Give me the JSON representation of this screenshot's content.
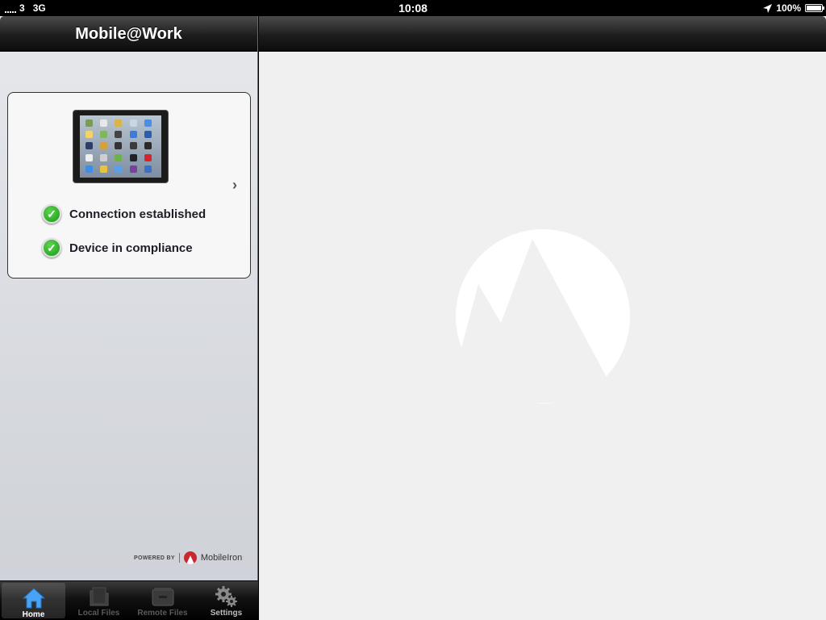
{
  "status_bar": {
    "carrier": "3",
    "network": "3G",
    "time": "10:08",
    "battery": "100%",
    "battery_level": 1.0,
    "location_icon": "location-arrow-icon"
  },
  "master": {
    "title": "Mobile@Work",
    "device_card": {
      "chevron_icon": "chevron-right-icon",
      "statuses": [
        {
          "label": "Connection established",
          "icon": "check-icon"
        },
        {
          "label": "Device in compliance",
          "icon": "check-icon"
        }
      ]
    },
    "powered_by": {
      "prefix": "POWERED BY",
      "brand": "MobileIron"
    }
  },
  "tabbar": {
    "tabs": [
      {
        "label": "Home",
        "icon": "home-icon",
        "active": true
      },
      {
        "label": "Local Files",
        "icon": "folder-icon",
        "active": false
      },
      {
        "label": "Remote Files",
        "icon": "file-cabinet-icon",
        "active": false
      },
      {
        "label": "Settings",
        "icon": "gear-icon",
        "active": false
      }
    ]
  },
  "detail": {
    "watermark": "mobileiron-logo-icon"
  },
  "colors": {
    "accent_green": "#159a13",
    "brand_red": "#c9262f",
    "active_tab_blue": "#4aa3f2"
  }
}
